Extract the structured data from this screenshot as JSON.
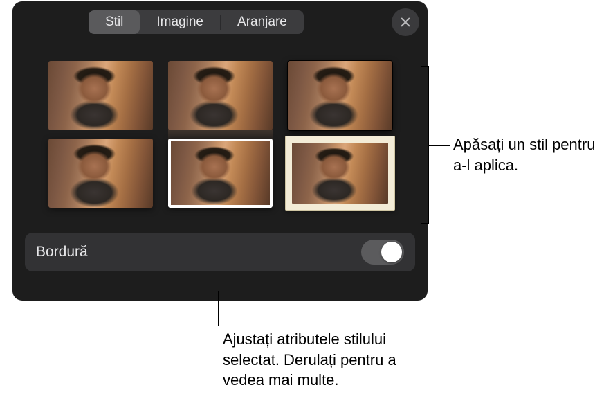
{
  "tabs": {
    "style": "Stil",
    "image": "Imagine",
    "arrange": "Aranjare",
    "active": "style"
  },
  "close_label": "Close",
  "styles": [
    {
      "name": "style-plain"
    },
    {
      "name": "style-reflection"
    },
    {
      "name": "style-dark-shadow"
    },
    {
      "name": "style-soft-shadow"
    },
    {
      "name": "style-white-border"
    },
    {
      "name": "style-photo-frame"
    }
  ],
  "border": {
    "label": "Bordură",
    "enabled": false
  },
  "callouts": {
    "apply_style": "Apăsați un stil pentru a-l aplica.",
    "adjust_attributes": "Ajustați atributele stilului selectat. Derulați pentru a vedea mai multe."
  }
}
